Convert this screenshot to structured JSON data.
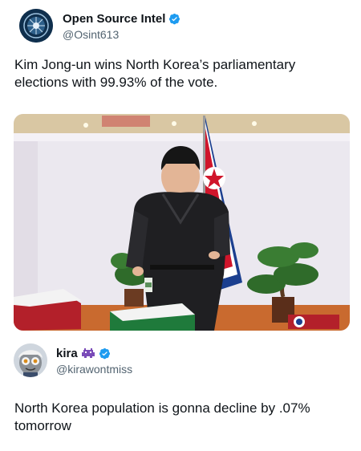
{
  "post1": {
    "author_name": "Open Source Intel",
    "author_handle": "@Osint613",
    "text": "Kim Jong-un wins North Korea’s parliamentary elections with 99.93% of the vote."
  },
  "post2": {
    "author_name": "kira",
    "author_handle": "@kirawontmiss",
    "text": "North Korea population is gonna decline by .07% tomorrow"
  },
  "colors": {
    "verified": "#1d9bf0",
    "flag_red": "#d0152b",
    "flag_blue": "#1b3f8f"
  }
}
